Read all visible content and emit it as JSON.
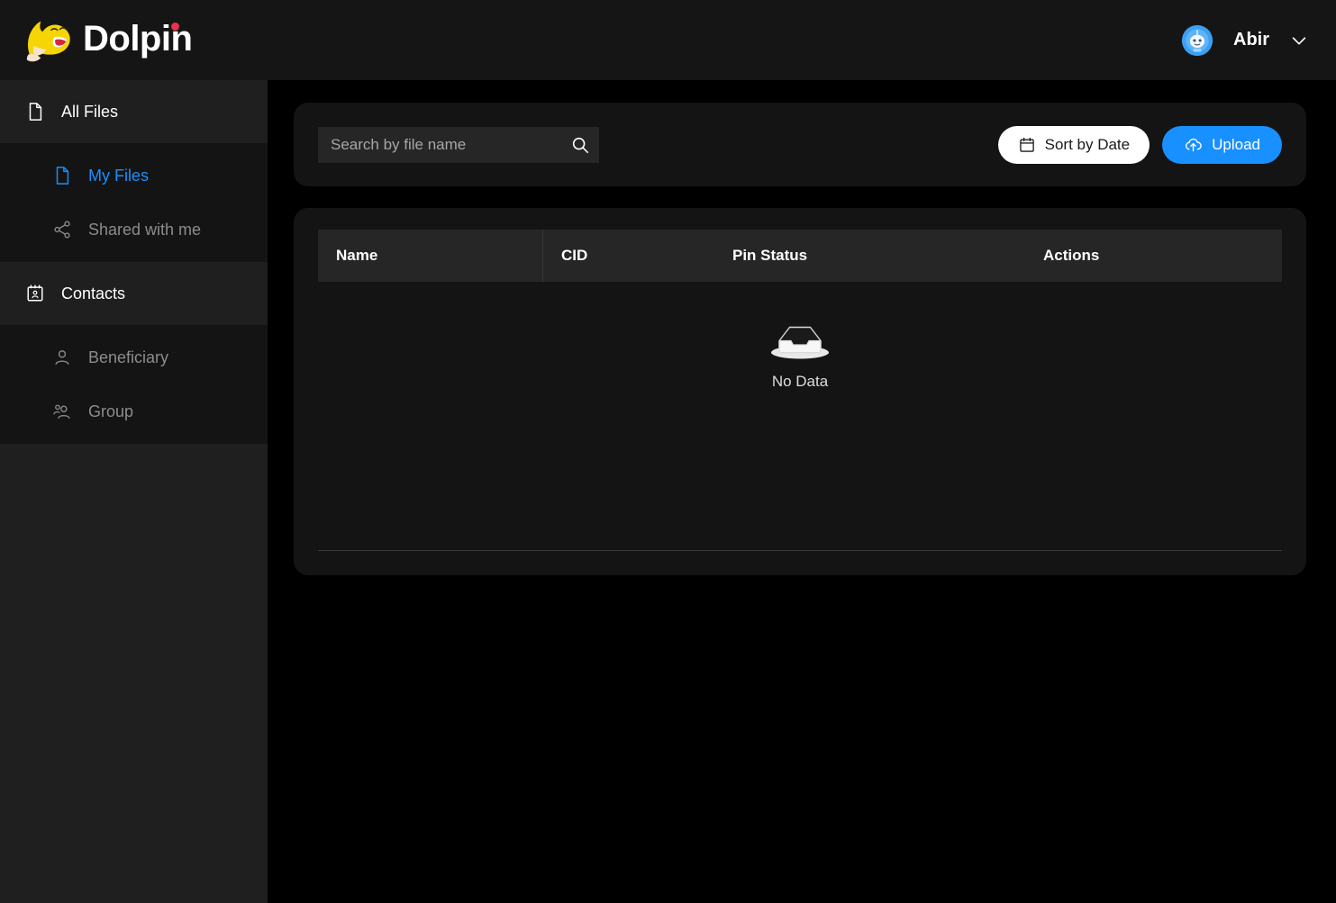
{
  "header": {
    "brand_name": "Dolpin",
    "logo_icon": "dolphin-logo",
    "user_name": "Abir",
    "avatar_icon": "user-avatar",
    "chevron_icon": "chevron-down-icon"
  },
  "sidebar": {
    "sections": [
      {
        "label": "All Files",
        "icon": "file-icon",
        "items": [
          {
            "label": "My Files",
            "icon": "file-icon",
            "active": true
          },
          {
            "label": "Shared with me",
            "icon": "share-icon",
            "active": false
          }
        ]
      },
      {
        "label": "Contacts",
        "icon": "contacts-book-icon",
        "items": [
          {
            "label": "Beneficiary",
            "icon": "user-icon",
            "active": false
          },
          {
            "label": "Group",
            "icon": "users-group-icon",
            "active": false
          }
        ]
      }
    ]
  },
  "toolbar": {
    "search_placeholder": "Search by file name",
    "search_value": "",
    "search_icon": "search-icon",
    "sort_label": "Sort by Date",
    "sort_icon": "calendar-icon",
    "upload_label": "Upload",
    "upload_icon": "cloud-upload-icon"
  },
  "table": {
    "columns": [
      "Name",
      "CID",
      "Pin Status",
      "Actions"
    ],
    "rows": [],
    "empty_label": "No Data",
    "empty_icon": "empty-box-icon"
  },
  "colors": {
    "page_background": "#000000",
    "panel_background": "#141414",
    "sidebar_background": "#1f1f1f",
    "accent_blue": "#1890ff",
    "logo_yellow": "#f5d505",
    "logo_dot_red": "#e8334a"
  }
}
